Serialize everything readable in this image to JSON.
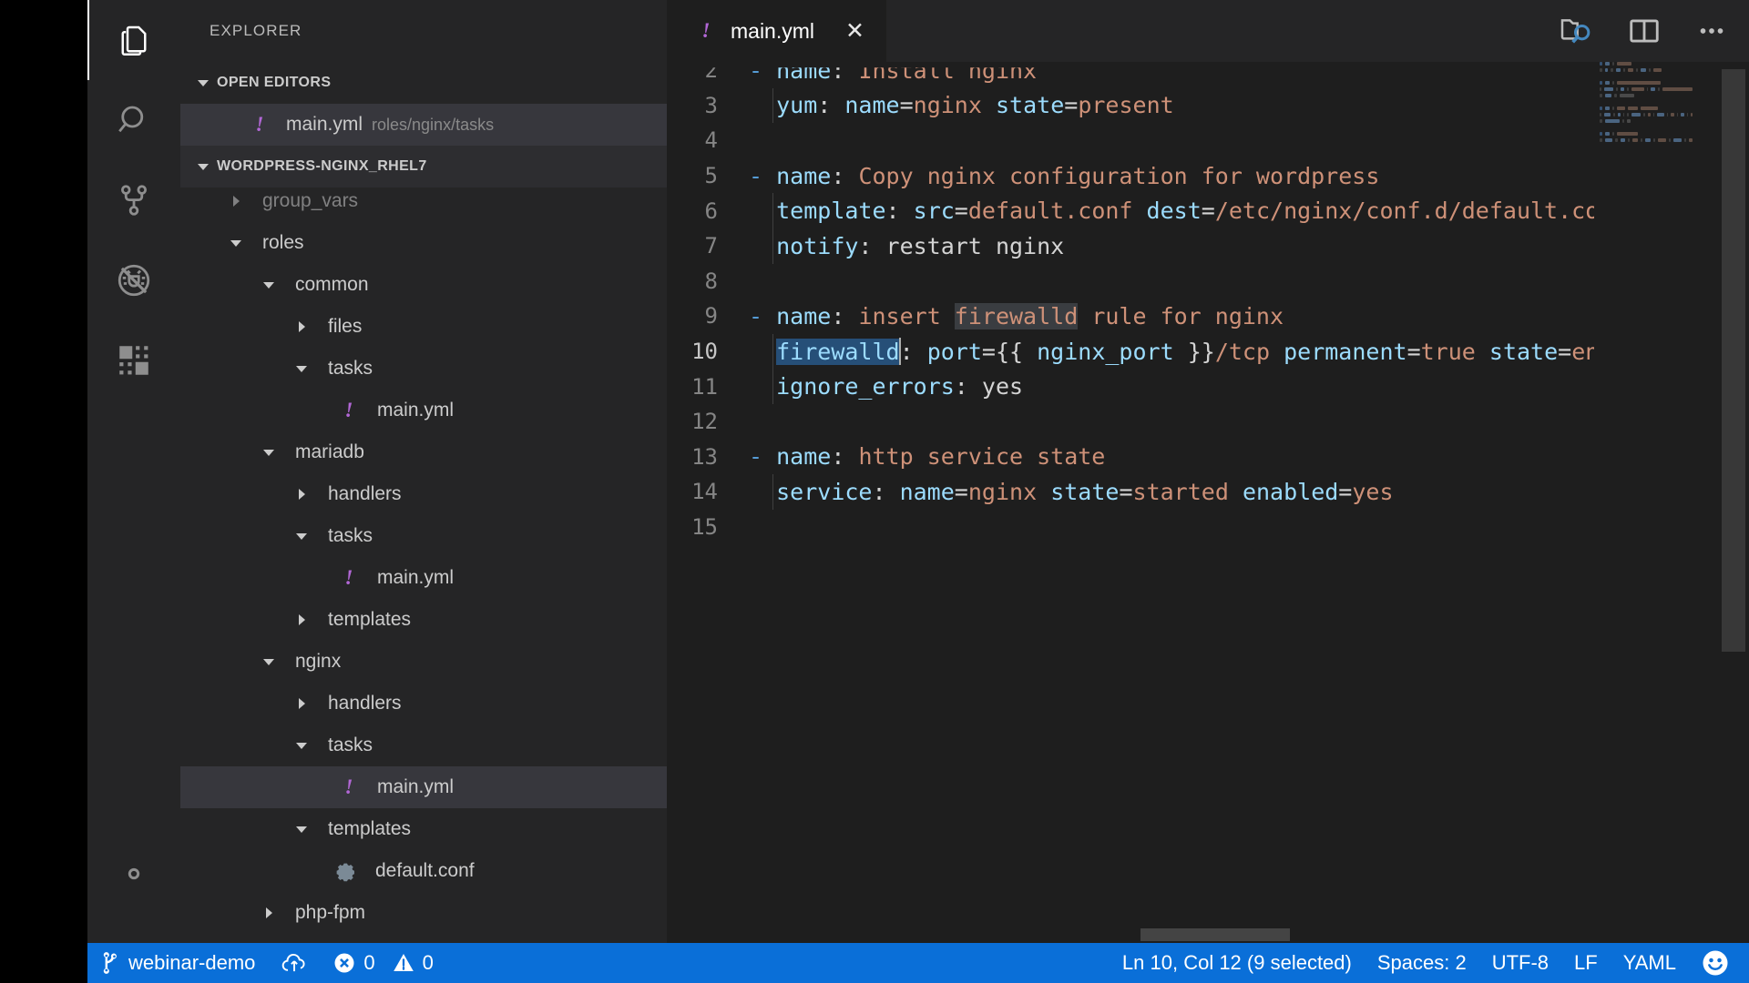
{
  "window": {
    "title": "main.yml"
  },
  "activitybar": {
    "items": [
      {
        "name": "explorer-icon",
        "active": true
      },
      {
        "name": "search-icon",
        "active": false
      },
      {
        "name": "source-control-icon",
        "active": false
      },
      {
        "name": "debug-icon",
        "active": false
      },
      {
        "name": "extensions-icon",
        "active": false
      }
    ],
    "settings": {
      "name": "manage-gear-icon",
      "label": "Manage"
    }
  },
  "sidebar": {
    "title": "EXPLORER",
    "open_editors": {
      "header": "OPEN EDITORS",
      "expanded": true,
      "items": [
        {
          "name": "main.yml",
          "description": "roles/nginx/tasks",
          "icon": "yaml-icon",
          "active": true
        }
      ]
    },
    "workspace": {
      "header": "WORDPRESS-NGINX_RHEL7",
      "expanded": true,
      "tree": [
        {
          "label": "group_vars",
          "depth": 1,
          "kind": "folder",
          "expanded": false,
          "clipped": true
        },
        {
          "label": "roles",
          "depth": 1,
          "kind": "folder",
          "expanded": true
        },
        {
          "label": "common",
          "depth": 2,
          "kind": "folder",
          "expanded": true
        },
        {
          "label": "files",
          "depth": 3,
          "kind": "folder",
          "expanded": false
        },
        {
          "label": "tasks",
          "depth": 3,
          "kind": "folder",
          "expanded": true
        },
        {
          "label": "main.yml",
          "depth": 4,
          "kind": "yaml"
        },
        {
          "label": "mariadb",
          "depth": 2,
          "kind": "folder",
          "expanded": true
        },
        {
          "label": "handlers",
          "depth": 3,
          "kind": "folder",
          "expanded": false
        },
        {
          "label": "tasks",
          "depth": 3,
          "kind": "folder",
          "expanded": true
        },
        {
          "label": "main.yml",
          "depth": 4,
          "kind": "yaml"
        },
        {
          "label": "templates",
          "depth": 3,
          "kind": "folder",
          "expanded": false
        },
        {
          "label": "nginx",
          "depth": 2,
          "kind": "folder",
          "expanded": true
        },
        {
          "label": "handlers",
          "depth": 3,
          "kind": "folder",
          "expanded": false
        },
        {
          "label": "tasks",
          "depth": 3,
          "kind": "folder",
          "expanded": true
        },
        {
          "label": "main.yml",
          "depth": 4,
          "kind": "yaml",
          "selected": true
        },
        {
          "label": "templates",
          "depth": 3,
          "kind": "folder",
          "expanded": true
        },
        {
          "label": "default.conf",
          "depth": 4,
          "kind": "conf"
        },
        {
          "label": "php-fpm",
          "depth": 2,
          "kind": "folder",
          "expanded": false
        }
      ]
    }
  },
  "editor": {
    "tab": {
      "label": "main.yml",
      "icon": "yaml-icon",
      "close": "✕",
      "dirty": false
    },
    "actions": [
      {
        "name": "open-preview-icon",
        "title": "Open Preview"
      },
      {
        "name": "split-editor-icon",
        "title": "Split Editor"
      },
      {
        "name": "more-actions-icon",
        "title": "More Actions..."
      }
    ],
    "first_visible_line": 2,
    "lines": [
      {
        "n": 2,
        "tokens": [
          {
            "t": "- ",
            "c": "dash"
          },
          {
            "t": "name",
            "c": "k"
          },
          {
            "t": ": ",
            "c": "p"
          },
          {
            "t": "Install nginx",
            "c": "s"
          }
        ],
        "partial": true
      },
      {
        "n": 3,
        "indent_guide": true,
        "tokens": [
          {
            "t": "  ",
            "c": "p"
          },
          {
            "t": "yum",
            "c": "k"
          },
          {
            "t": ": ",
            "c": "p"
          },
          {
            "t": "name",
            "c": "k"
          },
          {
            "t": "=",
            "c": "p"
          },
          {
            "t": "nginx",
            "c": "s"
          },
          {
            "t": " ",
            "c": "p"
          },
          {
            "t": "state",
            "c": "k"
          },
          {
            "t": "=",
            "c": "p"
          },
          {
            "t": "present",
            "c": "s"
          }
        ]
      },
      {
        "n": 4,
        "tokens": []
      },
      {
        "n": 5,
        "tokens": [
          {
            "t": "- ",
            "c": "dash"
          },
          {
            "t": "name",
            "c": "k"
          },
          {
            "t": ": ",
            "c": "p"
          },
          {
            "t": "Copy nginx configuration for wordpress",
            "c": "s"
          }
        ]
      },
      {
        "n": 6,
        "indent_guide": true,
        "tokens": [
          {
            "t": "  ",
            "c": "p"
          },
          {
            "t": "template",
            "c": "k"
          },
          {
            "t": ": ",
            "c": "p"
          },
          {
            "t": "src",
            "c": "k"
          },
          {
            "t": "=",
            "c": "p"
          },
          {
            "t": "default.conf",
            "c": "s"
          },
          {
            "t": " ",
            "c": "p"
          },
          {
            "t": "dest",
            "c": "k"
          },
          {
            "t": "=",
            "c": "p"
          },
          {
            "t": "/etc/nginx/conf.d/default.co",
            "c": "s"
          }
        ],
        "truncated": true
      },
      {
        "n": 7,
        "indent_guide": true,
        "tokens": [
          {
            "t": "  ",
            "c": "p"
          },
          {
            "t": "notify",
            "c": "k"
          },
          {
            "t": ": ",
            "c": "p"
          },
          {
            "t": "restart nginx",
            "c": "w"
          }
        ]
      },
      {
        "n": 8,
        "tokens": []
      },
      {
        "n": 9,
        "tokens": [
          {
            "t": "- ",
            "c": "dash"
          },
          {
            "t": "name",
            "c": "k"
          },
          {
            "t": ": ",
            "c": "p"
          },
          {
            "t": "insert ",
            "c": "s"
          },
          {
            "t": "firewalld",
            "c": "s",
            "hl": "match"
          },
          {
            "t": " rule for nginx",
            "c": "s"
          }
        ]
      },
      {
        "n": 10,
        "current": true,
        "indent_guide": true,
        "tokens": [
          {
            "t": "  ",
            "c": "p"
          },
          {
            "t": "firewalld",
            "c": "k",
            "hl": "sel"
          },
          {
            "t": "CARET",
            "c": "caret"
          },
          {
            "t": ": ",
            "c": "p"
          },
          {
            "t": "port",
            "c": "k"
          },
          {
            "t": "=",
            "c": "p"
          },
          {
            "t": "{{",
            "c": "p"
          },
          {
            "t": " nginx_port ",
            "c": "var"
          },
          {
            "t": "}}",
            "c": "p"
          },
          {
            "t": "/tcp",
            "c": "s"
          },
          {
            "t": " ",
            "c": "p"
          },
          {
            "t": "permanent",
            "c": "k"
          },
          {
            "t": "=",
            "c": "p"
          },
          {
            "t": "true",
            "c": "s"
          },
          {
            "t": " ",
            "c": "p"
          },
          {
            "t": "state",
            "c": "k"
          },
          {
            "t": "=",
            "c": "p"
          },
          {
            "t": "en",
            "c": "s"
          }
        ],
        "truncated": true
      },
      {
        "n": 11,
        "indent_guide": true,
        "tokens": [
          {
            "t": "  ",
            "c": "p"
          },
          {
            "t": "ignore_errors",
            "c": "k"
          },
          {
            "t": ": ",
            "c": "p"
          },
          {
            "t": "yes",
            "c": "w"
          }
        ]
      },
      {
        "n": 12,
        "tokens": []
      },
      {
        "n": 13,
        "tokens": [
          {
            "t": "- ",
            "c": "dash"
          },
          {
            "t": "name",
            "c": "k"
          },
          {
            "t": ": ",
            "c": "p"
          },
          {
            "t": "http service state",
            "c": "s"
          }
        ]
      },
      {
        "n": 14,
        "indent_guide": true,
        "tokens": [
          {
            "t": "  ",
            "c": "p"
          },
          {
            "t": "service",
            "c": "k"
          },
          {
            "t": ": ",
            "c": "p"
          },
          {
            "t": "name",
            "c": "k"
          },
          {
            "t": "=",
            "c": "p"
          },
          {
            "t": "nginx",
            "c": "s"
          },
          {
            "t": " ",
            "c": "p"
          },
          {
            "t": "state",
            "c": "k"
          },
          {
            "t": "=",
            "c": "p"
          },
          {
            "t": "started",
            "c": "s"
          },
          {
            "t": " ",
            "c": "p"
          },
          {
            "t": "enabled",
            "c": "k"
          },
          {
            "t": "=",
            "c": "p"
          },
          {
            "t": "yes",
            "c": "s"
          }
        ]
      },
      {
        "n": 15,
        "tokens": []
      }
    ]
  },
  "statusbar": {
    "branch": "webinar-demo",
    "sync": "sync-icon",
    "errors": "0",
    "warnings": "0",
    "position": "Ln 10, Col 12 (9 selected)",
    "indentation": "Spaces: 2",
    "encoding": "UTF-8",
    "eol": "LF",
    "language": "YAML",
    "feedback": "feedback-smiley-icon",
    "background": "#0a6fd8"
  },
  "colors": {
    "editor_bg": "#1e1e1e",
    "sidebar_bg": "#252526",
    "selection": "#264f78",
    "accent": "#0a6fd8",
    "yaml_icon": "#b267d6"
  }
}
